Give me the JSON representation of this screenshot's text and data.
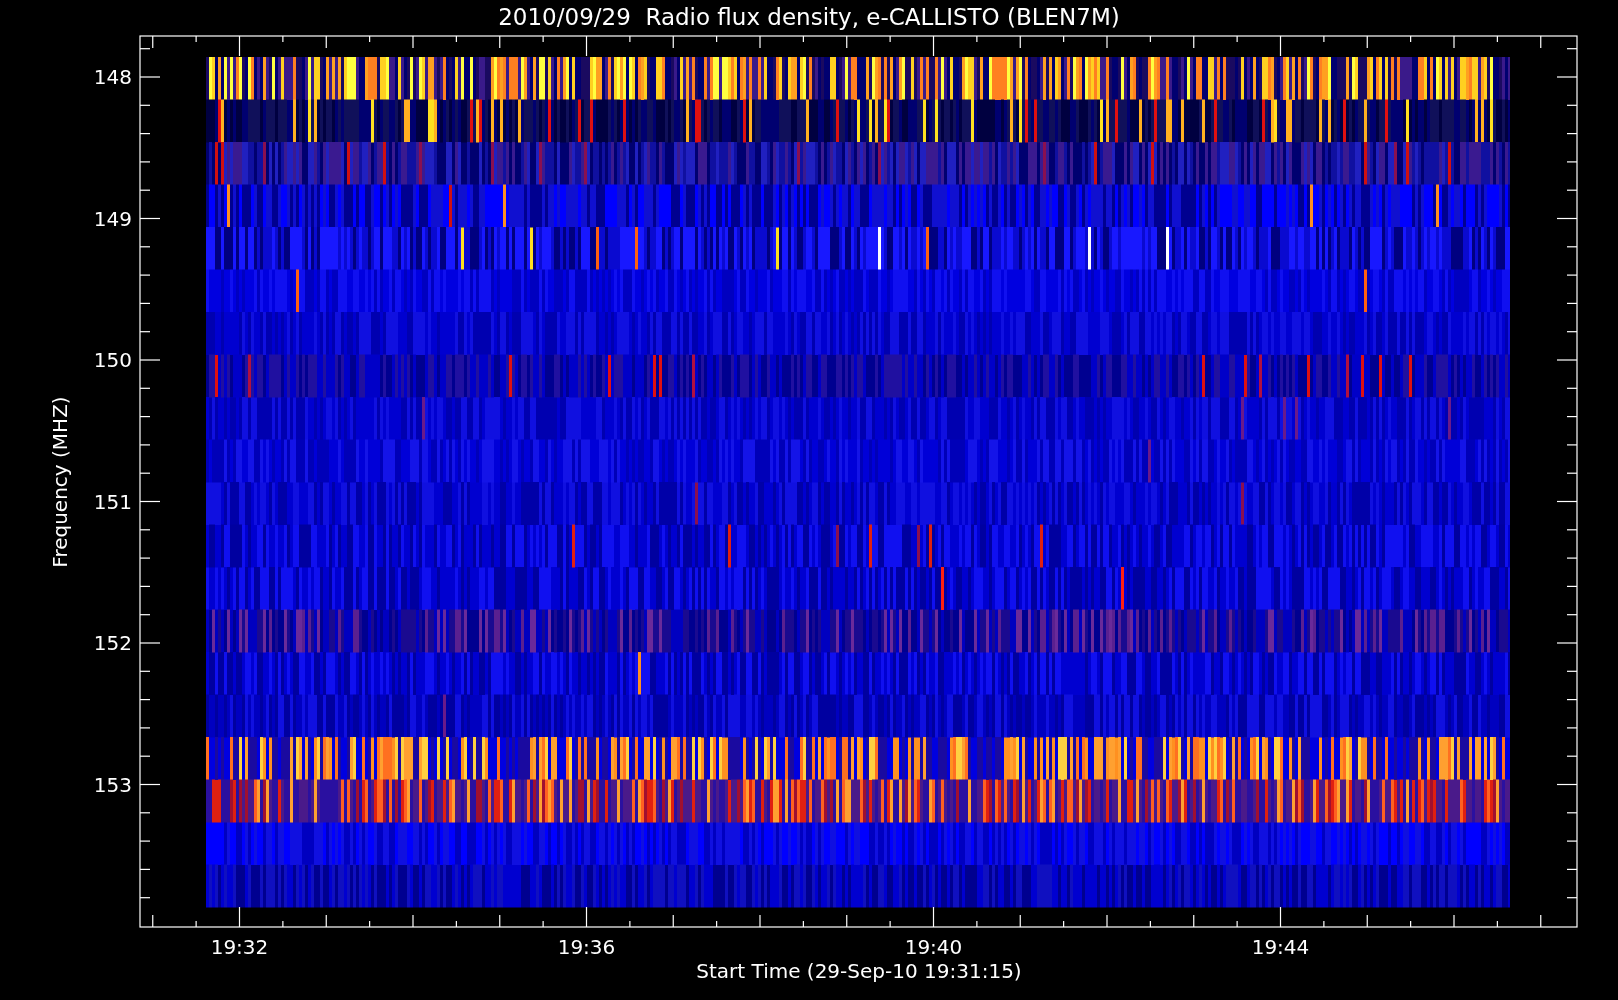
{
  "title": "2010/09/29  Radio flux density, e-CALLISTO (BLEN7M)",
  "ylabel": "Frequency (MHZ)",
  "xlabel": "Start Time (29-Sep-10 19:31:15)",
  "yticks": [
    "148",
    "149",
    "150",
    "151",
    "152",
    "153"
  ],
  "xticks": [
    "19:32",
    "19:36",
    "19:40",
    "19:44"
  ]
}
